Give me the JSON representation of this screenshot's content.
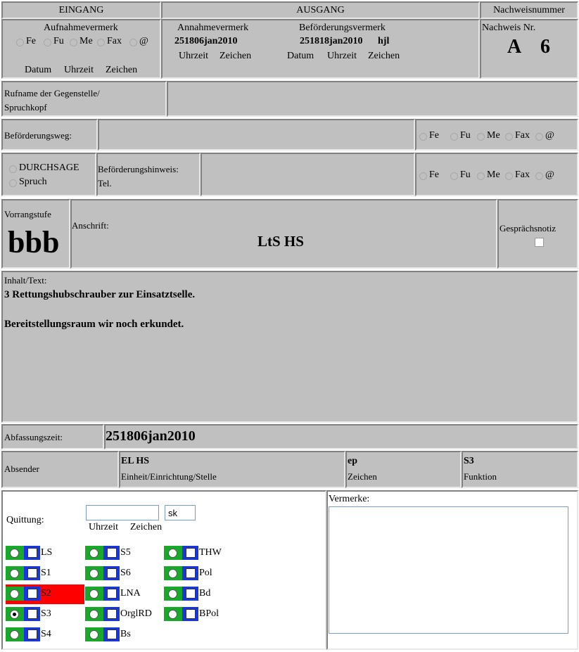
{
  "header": {
    "eingang": "EINGANG",
    "ausgang": "AUSGANG",
    "nachweisnummer": "Nachweisnummer"
  },
  "eingang": {
    "aufnahmevermerk": "Aufnahmevermerk",
    "channels": [
      "Fe",
      "Fu",
      "Me",
      "Fax",
      "@"
    ],
    "datum": "Datum",
    "uhrzeit": "Uhrzeit",
    "zeichen": "Zeichen"
  },
  "ausgang": {
    "annahmevermerk": "Annahmevermerk",
    "annahme_value": "251806jan2010",
    "beforderungsvermerk": "Beförderungsvermerk",
    "beforderung_value": "251818jan2010",
    "beforderung_zeichen": "hjl",
    "uhrzeit": "Uhrzeit",
    "zeichen": "Zeichen",
    "datum": "Datum"
  },
  "nachweis": {
    "label": "Nachweis Nr.",
    "prefix": "A",
    "number": "6"
  },
  "rufname": {
    "label_line1": "Rufname der Gegenstelle/",
    "label_line2": "Spruchkopf",
    "value": ""
  },
  "beforderungsweg": {
    "label": "Beförderungsweg:",
    "value": "",
    "channels": [
      "Fe",
      "Fu",
      "Me",
      "Fax",
      "@"
    ]
  },
  "durchsage": {
    "option1": "DURCHSAGE",
    "option2": "Spruch",
    "hinweis_label": "Beförderungshinweis:",
    "tel_label": "Tel.",
    "value": "",
    "channels": [
      "Fe",
      "Fu",
      "Me",
      "Fax",
      "@"
    ]
  },
  "vorrang": {
    "label": "Vorrangstufe",
    "value": "bbb"
  },
  "anschrift": {
    "label": "Anschrift:",
    "value": "LtS HS"
  },
  "gesprachsnotiz": {
    "label": "Gesprächsnotiz",
    "checked": false
  },
  "inhalt": {
    "label": "Inhalt/Text:",
    "line1": "3 Rettungshubschrauber zur Einsatztselle.",
    "line2": "Bereitstellungsraum wir noch erkundet."
  },
  "abfassung": {
    "label": "Abfassungszeit:",
    "value": "251806jan2010"
  },
  "absender": {
    "label": "Absender",
    "einheit_value": "EL HS",
    "einheit_label": "Einheit/Einrichtung/Stelle",
    "zeichen_value": "ep",
    "zeichen_label": "Zeichen",
    "funktion_value": "S3",
    "funktion_label": "Funktion"
  },
  "quittung": {
    "label": "Quittung:",
    "uhrzeit_value": "",
    "zeichen_value": "sk",
    "uhrzeit_label": "Uhrzeit",
    "zeichen_label": "Zeichen"
  },
  "vermerke": {
    "label": "Vermerke:",
    "value": ""
  },
  "recipients": {
    "col1": [
      {
        "label": "LS"
      },
      {
        "label": "S1"
      },
      {
        "label": "S2",
        "highlight": "#ff0000"
      },
      {
        "label": "S3",
        "selected": true
      },
      {
        "label": "S4"
      }
    ],
    "col2": [
      {
        "label": "S5"
      },
      {
        "label": "S6"
      },
      {
        "label": "LNA"
      },
      {
        "label": "OrglRD"
      },
      {
        "label": "Bs"
      }
    ],
    "col3": [
      {
        "label": "THW"
      },
      {
        "label": "Pol"
      },
      {
        "label": "Bd"
      },
      {
        "label": "BPol"
      }
    ]
  },
  "colors": {
    "panel": "#c0c0c0",
    "green": "#18a82a",
    "blue": "#1836e0",
    "highlight": "#ff0000"
  }
}
